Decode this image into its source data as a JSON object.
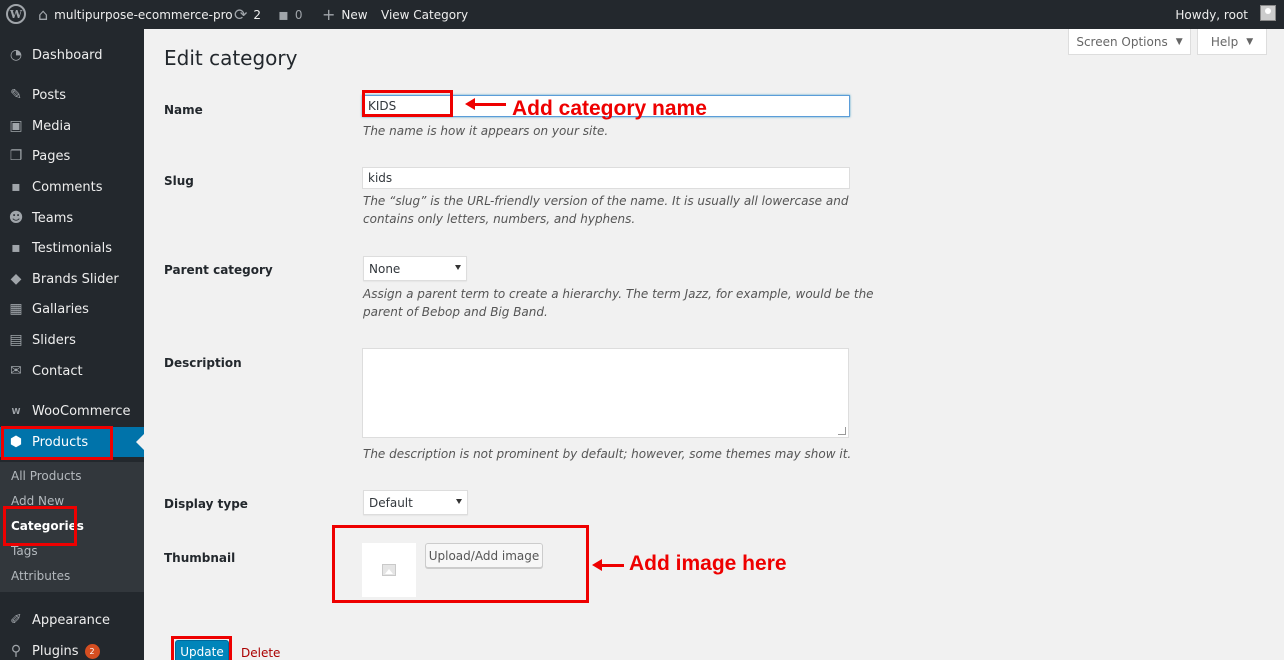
{
  "adminbar": {
    "site_name": "multipurpose-ecommerce-pro",
    "updates_count": "2",
    "comments_count": "0",
    "new_label": "New",
    "view_category_label": "View Category",
    "howdy": "Howdy, root"
  },
  "sidebar": {
    "items": [
      {
        "label": "Dashboard",
        "icon": "dashboard-icon"
      },
      {
        "label": "Posts",
        "icon": "pin-icon"
      },
      {
        "label": "Media",
        "icon": "media-icon"
      },
      {
        "label": "Pages",
        "icon": "pages-icon"
      },
      {
        "label": "Comments",
        "icon": "comment-icon"
      },
      {
        "label": "Teams",
        "icon": "groups-icon"
      },
      {
        "label": "Testimonials",
        "icon": "testimonial-icon"
      },
      {
        "label": "Brands Slider",
        "icon": "tag-icon"
      },
      {
        "label": "Gallaries",
        "icon": "gallery-icon"
      },
      {
        "label": "Sliders",
        "icon": "slides-icon"
      },
      {
        "label": "Contact",
        "icon": "email-icon"
      },
      {
        "label": "WooCommerce",
        "icon": "woo-icon"
      },
      {
        "label": "Products",
        "icon": "box-icon"
      },
      {
        "label": "Appearance",
        "icon": "brush-icon"
      },
      {
        "label": "Plugins",
        "icon": "plugin-icon",
        "badge": "2"
      }
    ],
    "submenu": [
      "All Products",
      "Add New",
      "Categories",
      "Tags",
      "Attributes"
    ]
  },
  "screen_options_label": "Screen Options",
  "help_label": "Help",
  "page_title": "Edit category",
  "form": {
    "name_label": "Name",
    "name_value": "KIDS",
    "name_desc": "The name is how it appears on your site.",
    "slug_label": "Slug",
    "slug_value": "kids",
    "slug_desc": "The “slug” is the URL-friendly version of the name. It is usually all lowercase and contains only letters, numbers, and hyphens.",
    "parent_label": "Parent category",
    "parent_value": "None",
    "parent_desc": "Assign a parent term to create a hierarchy. The term Jazz, for example, would be the parent of Bebop and Big Band.",
    "description_label": "Description",
    "description_desc": "The description is not prominent by default; however, some themes may show it.",
    "display_type_label": "Display type",
    "display_type_value": "Default",
    "thumbnail_label": "Thumbnail",
    "upload_button": "Upload/Add image",
    "update_button": "Update",
    "delete_link": "Delete"
  },
  "annotations": {
    "name_note": "Add category name",
    "image_note": "Add image here",
    "color": "#e00000"
  }
}
